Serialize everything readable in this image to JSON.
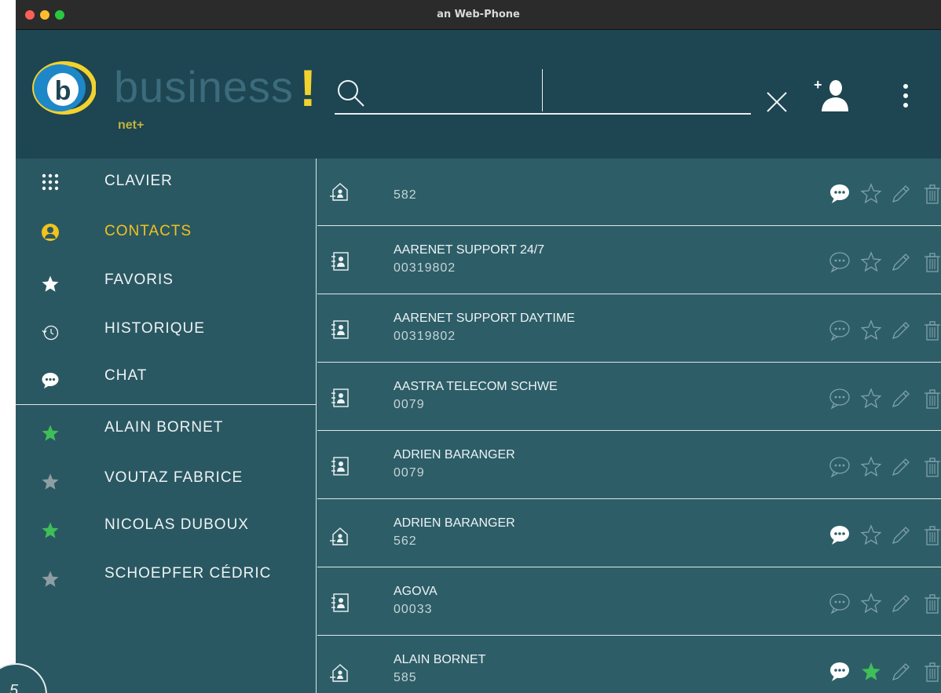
{
  "window": {
    "title": "an Web-Phone"
  },
  "brand": {
    "name": "business",
    "exclaim": "!",
    "sub": "net+"
  },
  "search": {
    "value": "",
    "placeholder": ""
  },
  "nav": [
    {
      "label": "CLAVIER",
      "icon": "keypad-icon",
      "active": false
    },
    {
      "label": "CONTACTS",
      "icon": "contacts-icon",
      "active": true
    },
    {
      "label": "FAVORIS",
      "icon": "star-icon",
      "active": false
    },
    {
      "label": "HISTORIQUE",
      "icon": "history-icon",
      "active": false
    },
    {
      "label": "CHAT",
      "icon": "chat-icon",
      "active": false
    }
  ],
  "favorites": [
    {
      "name": "ALAIN BORNET",
      "star_color": "#3fbf57"
    },
    {
      "name": "VOUTAZ FABRICE",
      "star_color": "#8e9ea3"
    },
    {
      "name": "NICOLAS DUBOUX",
      "star_color": "#3fbf57"
    },
    {
      "name": "SCHOEPFER CÉDRIC",
      "star_color": "#8e9ea3"
    }
  ],
  "contacts": [
    {
      "type": "internal",
      "name": "",
      "number": "582",
      "chat_active": true,
      "favorite": false
    },
    {
      "type": "directory",
      "name": "AARENET SUPPORT 24/7",
      "number": "00319802",
      "chat_active": false,
      "favorite": false
    },
    {
      "type": "directory",
      "name": "AARENET SUPPORT DAYTIME",
      "number": "00319802",
      "chat_active": false,
      "favorite": false
    },
    {
      "type": "directory",
      "name": "AASTRA TELECOM SCHWE",
      "number": "0079",
      "chat_active": false,
      "favorite": false
    },
    {
      "type": "directory",
      "name": "ADRIEN BARANGER",
      "number": "0079",
      "chat_active": false,
      "favorite": false
    },
    {
      "type": "internal",
      "name": "ADRIEN BARANGER",
      "number": "562",
      "chat_active": true,
      "favorite": false
    },
    {
      "type": "directory",
      "name": "AGOVA",
      "number": "00033",
      "chat_active": false,
      "favorite": false
    },
    {
      "type": "internal",
      "name": "ALAIN BORNET",
      "number": "585",
      "chat_active": true,
      "favorite": true
    }
  ],
  "badge": {
    "text": "5"
  },
  "colors": {
    "header_bg": "#1d4552",
    "panel_bg": "#2a5862",
    "active_nav": "#f2c21d",
    "favorite_star": "#3fbf57"
  }
}
